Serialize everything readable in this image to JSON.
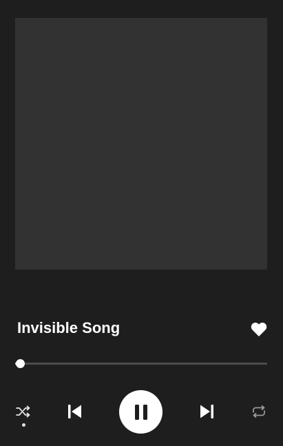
{
  "track": {
    "title": "Invisible Song",
    "liked": true
  },
  "playback": {
    "progress": 0.02,
    "state": "playing",
    "shuffle_enabled": true,
    "repeat_enabled": false
  },
  "icons": {
    "like": "heart-icon",
    "shuffle": "shuffle-icon",
    "previous": "skip-previous-icon",
    "play_pause": "pause-icon",
    "next": "skip-next-icon",
    "repeat": "repeat-icon"
  },
  "colors": {
    "background": "#1e1e1e",
    "album_art": "#323232",
    "text": "#ffffff",
    "track_rail": "#4d4d4d",
    "inactive_icon": "#9a9a9a"
  }
}
